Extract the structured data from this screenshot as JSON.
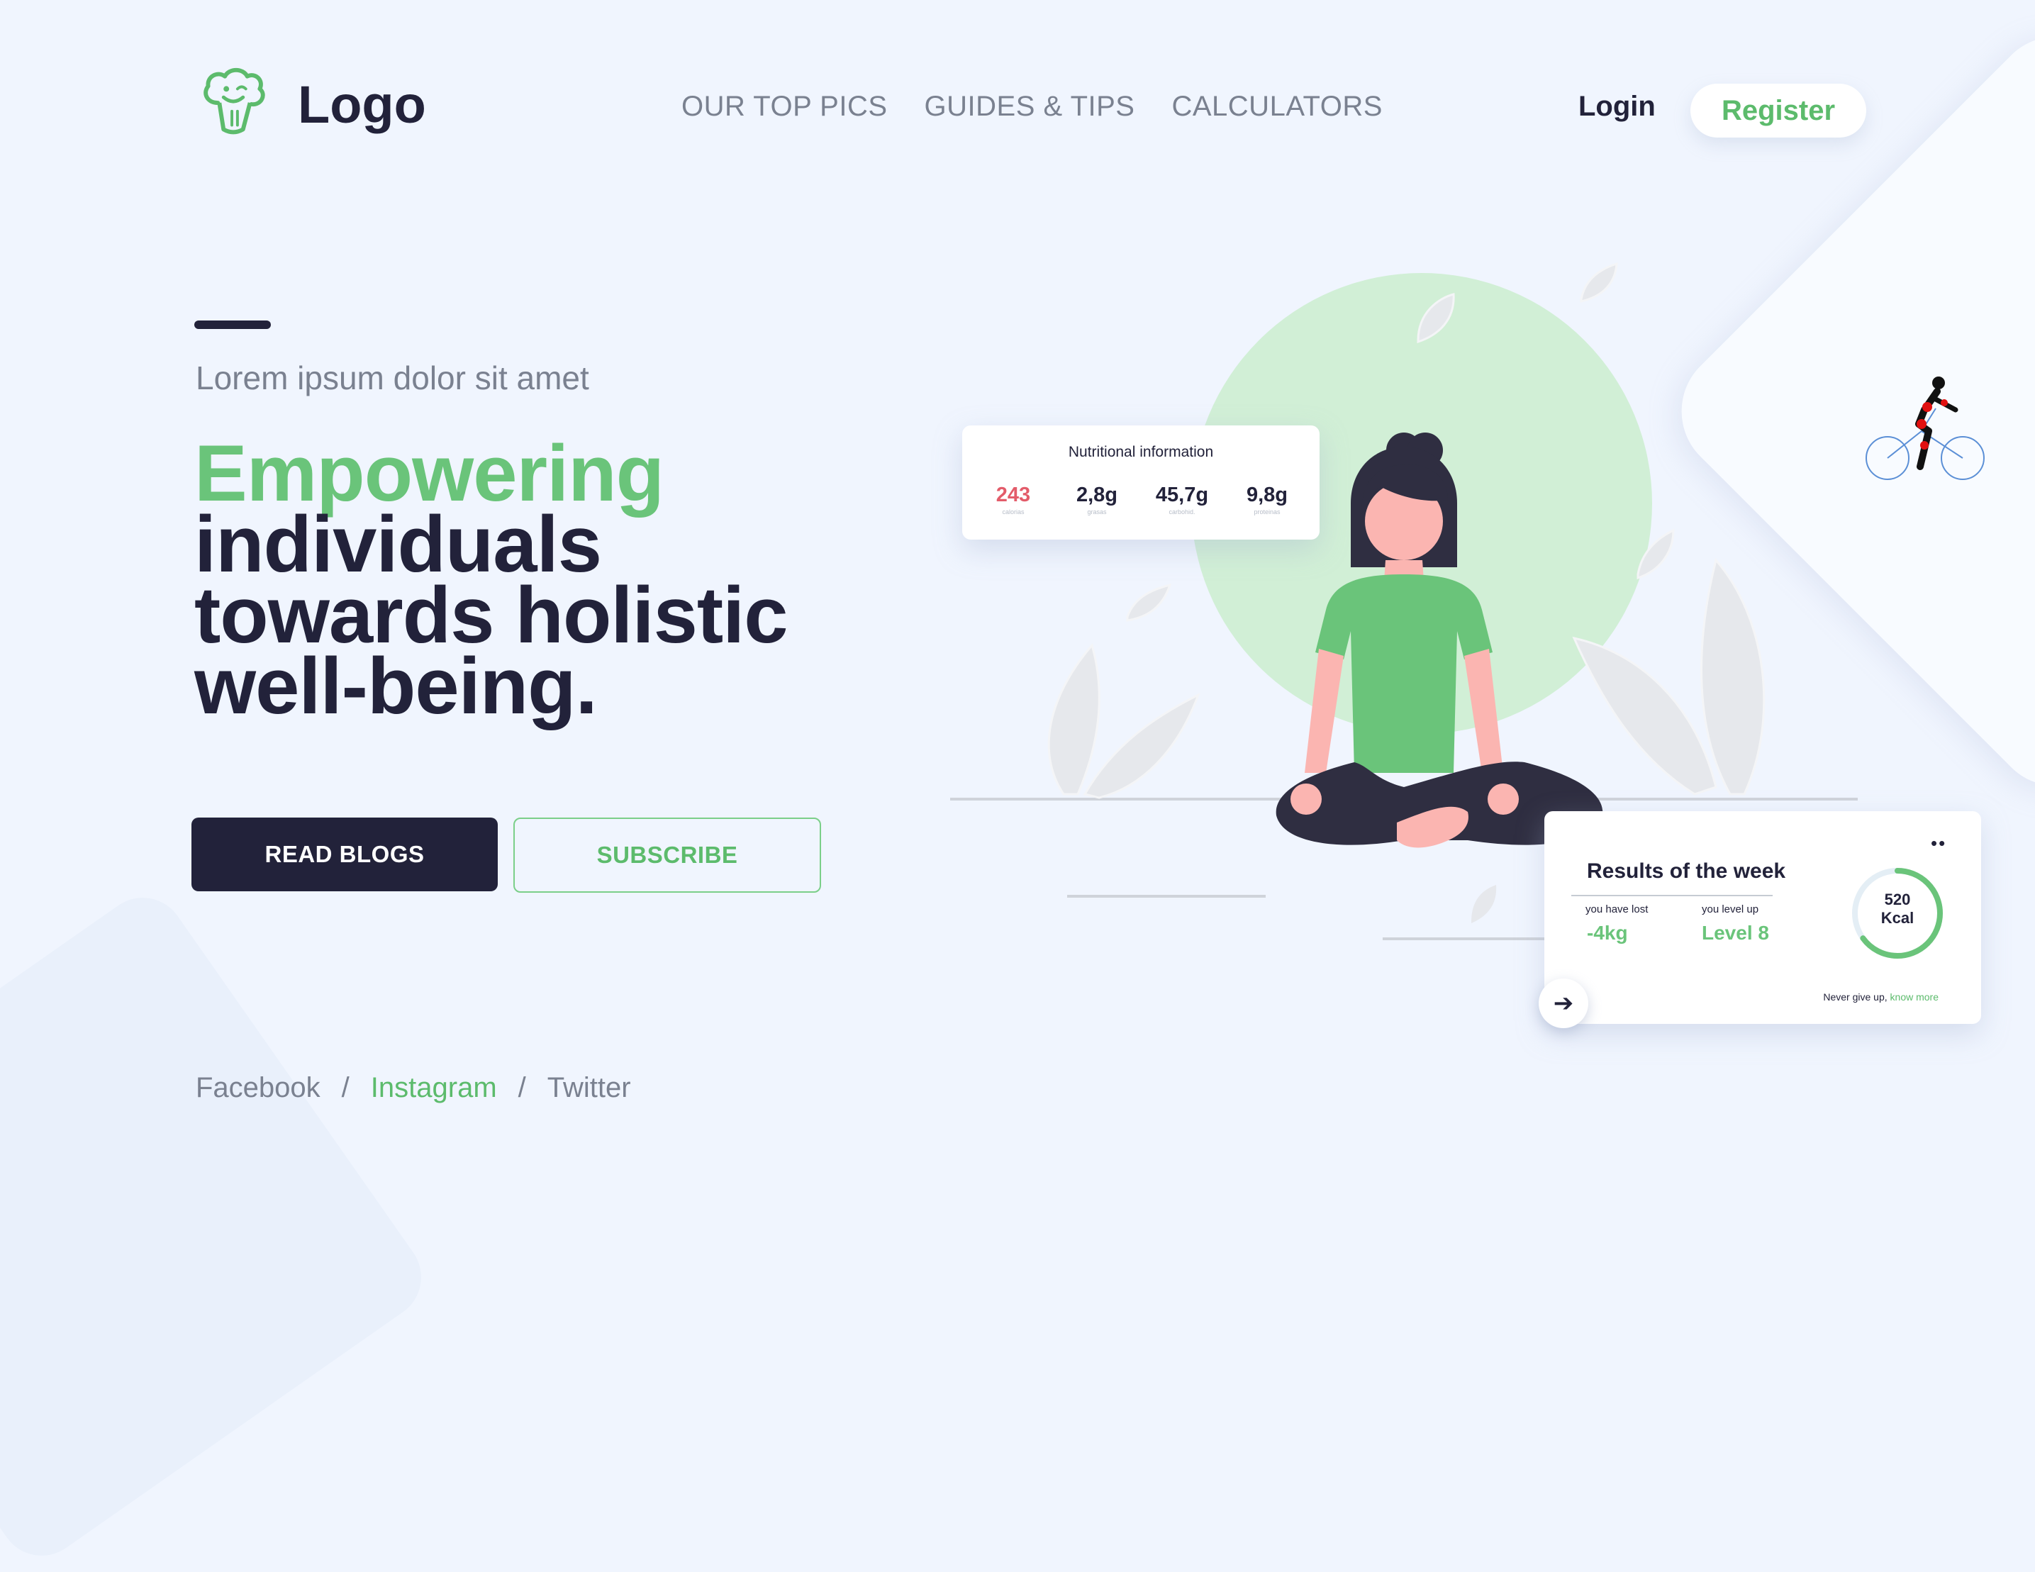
{
  "header": {
    "logo_text": "Logo",
    "nav": [
      "OUR TOP PICS",
      "GUIDES & TIPS",
      "CALCULATORS"
    ],
    "login": "Login",
    "register": "Register"
  },
  "hero": {
    "subtitle": "Lorem ipsum dolor sit amet",
    "headline_accent": "Empowering",
    "headline_lines": [
      "individuals",
      "towards holistic",
      "well-being."
    ],
    "primary_button": "READ BLOGS",
    "secondary_button": "SUBSCRIBE"
  },
  "social": {
    "facebook": "Facebook",
    "instagram": "Instagram",
    "twitter": "Twitter",
    "separator": "/"
  },
  "nutrition": {
    "title": "Nutritional information",
    "items": [
      {
        "value": "243",
        "label": "calorias"
      },
      {
        "value": "2,8g",
        "label": "grasas"
      },
      {
        "value": "45,7g",
        "label": "carbohid."
      },
      {
        "value": "9,8g",
        "label": "proteinas"
      }
    ]
  },
  "results": {
    "title": "Results of the week",
    "lost_label": "you have lost",
    "lost_value": "-4kg",
    "level_label": "you level up",
    "level_value": "Level 8",
    "kcal_value": "520",
    "kcal_unit": "Kcal",
    "gauge_fraction": 0.65,
    "note_text": "Never give up,",
    "note_link": "know more"
  },
  "colors": {
    "accent": "#6ac47a",
    "dark": "#22223a",
    "background": "#f0f5fe",
    "sun": "#d1efd6",
    "skin": "#fbb5b1"
  }
}
